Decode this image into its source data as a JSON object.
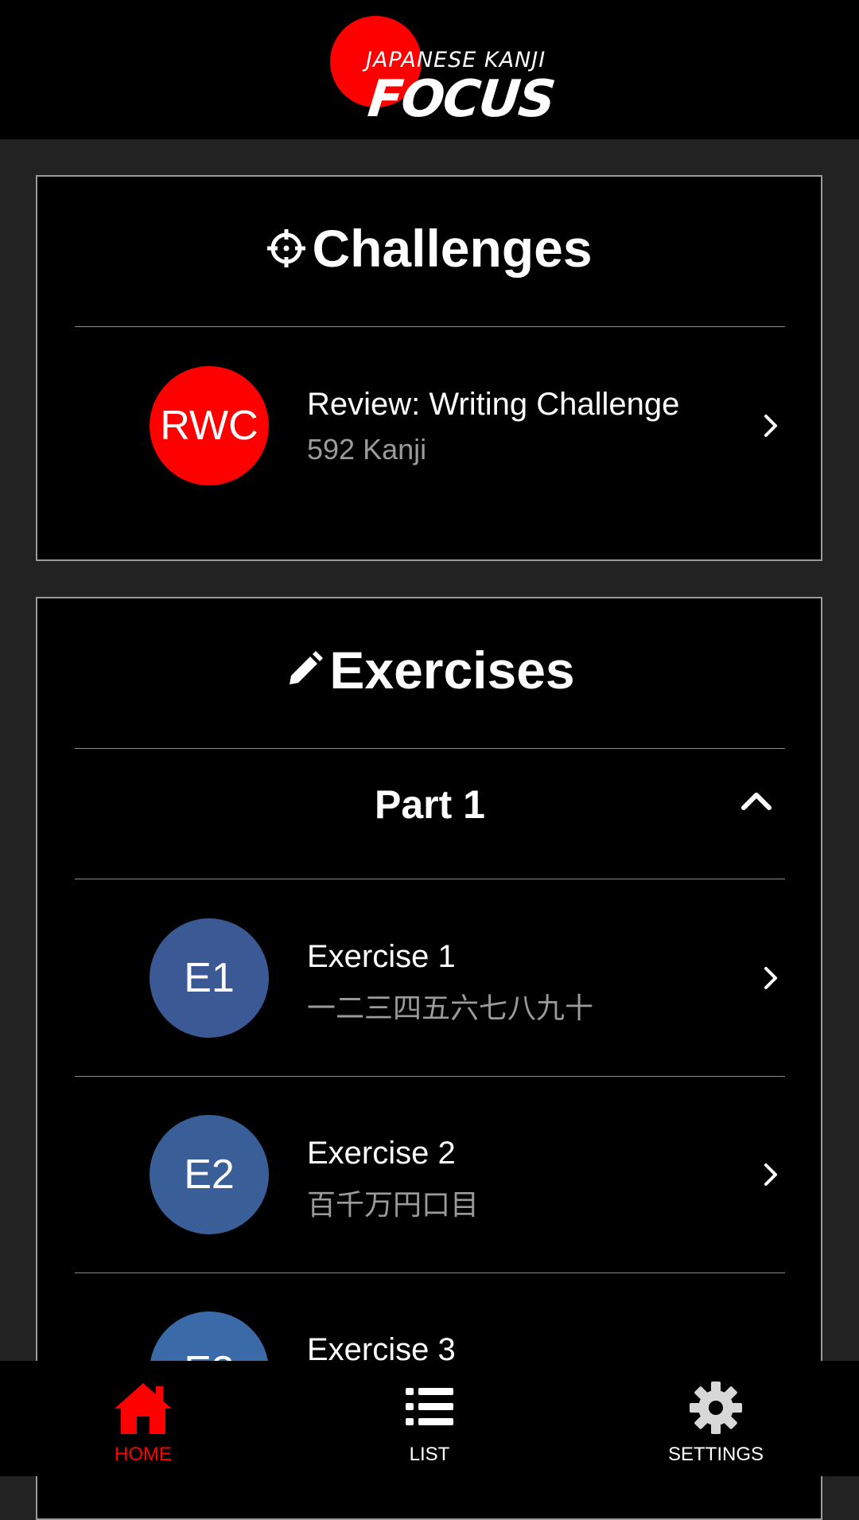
{
  "app": {
    "logo_line1": "JAPANESE KANJI",
    "logo_line2": "FOCUS"
  },
  "challenges": {
    "title": "Challenges",
    "items": [
      {
        "avatar": "RWC",
        "title": "Review: Writing Challenge",
        "subtitle": "592 Kanji",
        "color": "#ff0000"
      }
    ]
  },
  "exercises": {
    "title": "Exercises",
    "part_label": "Part 1",
    "items": [
      {
        "avatar": "E1",
        "title": "Exercise 1",
        "subtitle": "一二三四五六七八九十",
        "color": "#3b5a95"
      },
      {
        "avatar": "E2",
        "title": "Exercise 2",
        "subtitle": "百千万円口目",
        "color": "#3a5f98"
      },
      {
        "avatar": "E3",
        "title": "Exercise 3",
        "subtitle": "",
        "color": "#3a6aa8"
      }
    ]
  },
  "nav": {
    "home": "HOME",
    "list": "LIST",
    "settings": "SETTINGS",
    "active_color": "#ff0000"
  }
}
